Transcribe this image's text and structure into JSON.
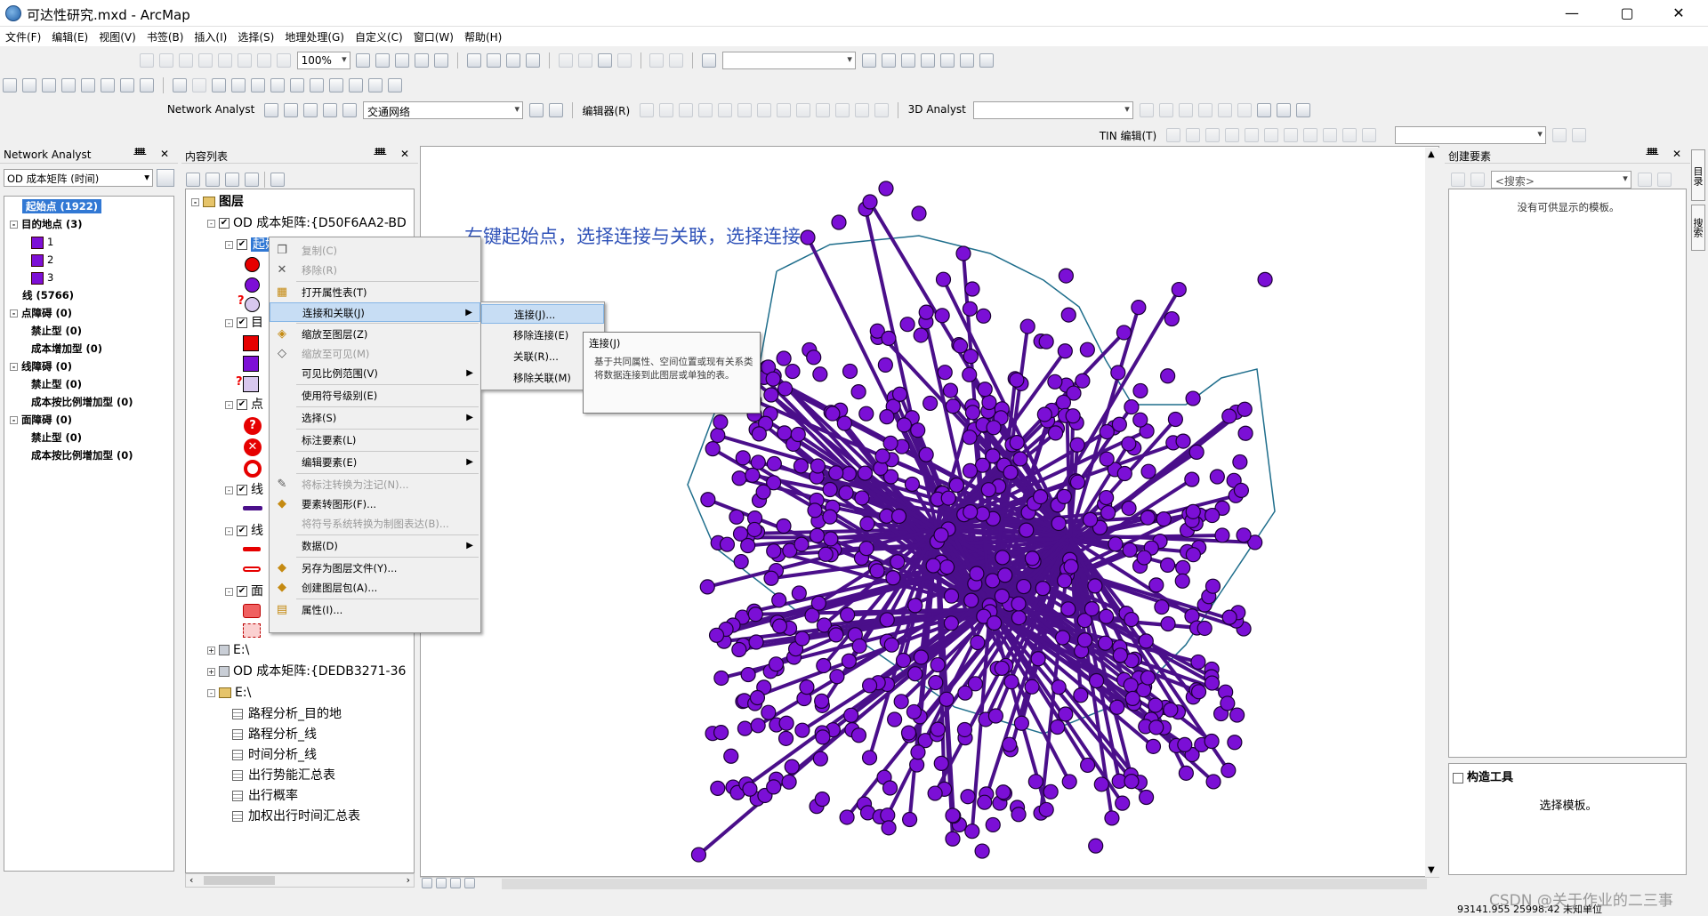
{
  "window": {
    "title": "可达性研究.mxd - ArcMap",
    "minimize": "—",
    "maximize": "▢",
    "close": "✕"
  },
  "menu": [
    "文件(F)",
    "编辑(E)",
    "视图(V)",
    "书签(B)",
    "插入(I)",
    "选择(S)",
    "地理处理(G)",
    "自定义(C)",
    "窗口(W)",
    "帮助(H)"
  ],
  "toolbar": {
    "zoom_level": "100%",
    "network_analyst_label": "Network Analyst",
    "network_dataset": "交通网络",
    "editor_label": "编辑器(R)",
    "analyst3d_label": "3D Analyst",
    "tin_label": "TIN 编辑(T)"
  },
  "na_panel": {
    "title": "Network Analyst",
    "layer_combo": "OD 成本矩阵 (时间)",
    "tree": [
      {
        "label": "起始点 (1922)",
        "bold": true,
        "selected": true,
        "indent": 0
      },
      {
        "label": "目的地点 (3)",
        "bold": true,
        "expander": "-",
        "indent": 0
      },
      {
        "label": "1",
        "symbol": "purple-square",
        "indent": 1
      },
      {
        "label": "2",
        "symbol": "purple-square",
        "indent": 1
      },
      {
        "label": "3",
        "symbol": "purple-square",
        "indent": 1
      },
      {
        "label": "线 (5766)",
        "bold": true,
        "indent": 0
      },
      {
        "label": "点障碍 (0)",
        "bold": true,
        "expander": "-",
        "indent": 0
      },
      {
        "label": "禁止型 (0)",
        "bold": true,
        "indent": 1
      },
      {
        "label": "成本增加型 (0)",
        "bold": true,
        "indent": 1
      },
      {
        "label": "线障碍 (0)",
        "bold": true,
        "expander": "-",
        "indent": 0
      },
      {
        "label": "禁止型 (0)",
        "bold": true,
        "indent": 1
      },
      {
        "label": "成本按比例增加型 (0)",
        "bold": true,
        "indent": 1
      },
      {
        "label": "面障碍 (0)",
        "bold": true,
        "expander": "-",
        "indent": 0
      },
      {
        "label": "禁止型 (0)",
        "bold": true,
        "indent": 1
      },
      {
        "label": "成本按比例增加型 (0)",
        "bold": true,
        "indent": 1
      }
    ]
  },
  "toc": {
    "title": "内容列表",
    "root": "图层",
    "od_layer": "OD 成本矩阵:{D50F6AA2-BD",
    "sublayer_initials": [
      "起始",
      "目",
      "点",
      "线",
      "线",
      "面"
    ],
    "od_layer2": "OD 成本矩阵:{DEDB3271-36",
    "drive1": "E:\\",
    "drive2": "E:\\",
    "tables": [
      "路程分析_目的地",
      "路程分析_线",
      "时间分析_线",
      "出行势能汇总表",
      "出行概率",
      "加权出行时间汇总表"
    ]
  },
  "context_menu": {
    "items": [
      {
        "label": "复制(C)",
        "disabled": true,
        "icon": "copy-icon"
      },
      {
        "label": "移除(R)",
        "disabled": true,
        "icon": "remove-icon"
      },
      {
        "label": "打开属性表(T)",
        "icon": "table-icon",
        "sep_before": true
      },
      {
        "label": "连接和关联(J)",
        "highlight": true,
        "submenu": true,
        "icon": ""
      },
      {
        "label": "缩放至图层(Z)",
        "icon": "zoom-layer-icon",
        "sep_before": true
      },
      {
        "label": "缩放至可见(M)",
        "disabled": true,
        "icon": "zoom-visible-icon"
      },
      {
        "label": "可见比例范围(V)",
        "submenu": true,
        "icon": ""
      },
      {
        "label": "使用符号级别(E)",
        "icon": "",
        "sep_before": true
      },
      {
        "label": "选择(S)",
        "submenu": true,
        "icon": "",
        "sep_before": true
      },
      {
        "label": "标注要素(L)",
        "icon": "",
        "sep_before": true
      },
      {
        "label": "编辑要素(E)",
        "submenu": true,
        "icon": "",
        "sep_before": true
      },
      {
        "label": "将标注转换为注记(N)...",
        "disabled": true,
        "icon": "convert-label-icon",
        "sep_before": true
      },
      {
        "label": "要素转图形(F)...",
        "icon": "feature-graphic-icon"
      },
      {
        "label": "将符号系统转换为制图表达(B)...",
        "disabled": true,
        "icon": ""
      },
      {
        "label": "数据(D)",
        "submenu": true,
        "icon": "",
        "sep_before": true
      },
      {
        "label": "另存为图层文件(Y)...",
        "icon": "save-layer-icon",
        "sep_before": true
      },
      {
        "label": "创建图层包(A)...",
        "icon": "layer-package-icon"
      },
      {
        "label": "属性(I)...",
        "icon": "properties-icon",
        "sep_before": true
      }
    ]
  },
  "submenu": {
    "items": [
      {
        "label": "连接(J)...",
        "highlight": true
      },
      {
        "label": "移除连接(E)",
        "arrow": true
      },
      {
        "label": "关联(R)..."
      },
      {
        "label": "移除关联(M)",
        "arrow": true
      }
    ]
  },
  "tooltip": {
    "title": "连接(J)",
    "body": "基于共同属性、空间位置或现有关系类将数据连接到此图层或单独的表。"
  },
  "map": {
    "annotation": "右键起始点，选择连接与关联，选择连接",
    "point_color": "#7b0fd6",
    "line_color": "#4a0f8a",
    "boundary_color": "#1f6e8c"
  },
  "create_features": {
    "title": "创建要素",
    "search_placeholder": "<搜索>",
    "empty_msg": "没有可供显示的模板。"
  },
  "construct_tools": {
    "title": "构造工具",
    "msg": "选择模板。"
  },
  "right_strip": [
    "目录",
    "搜索"
  ],
  "status": {
    "coords": "93141.955  25998.42 未知单位",
    "watermark": "CSDN @关于作业的二三事"
  }
}
